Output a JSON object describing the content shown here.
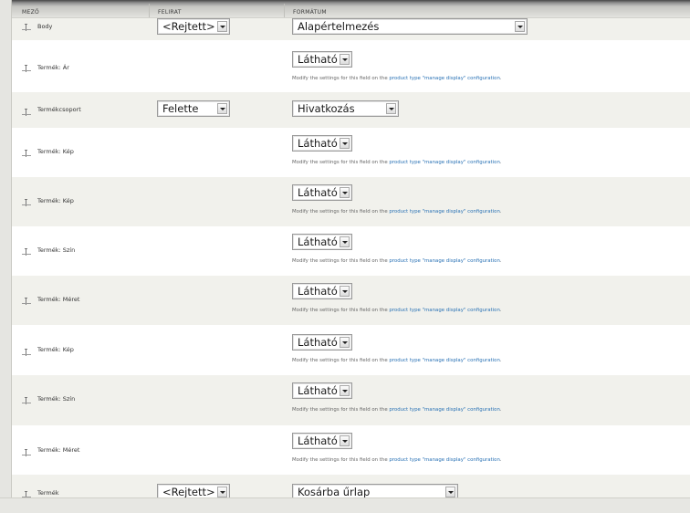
{
  "header": {
    "col_field": "MEZŐ",
    "col_label": "FELIRAT",
    "col_format": "FORMÁTUM"
  },
  "help": {
    "prefix": "Modify the settings for this field on the",
    "link": "product type \"manage display\" configuration",
    "suffix": "."
  },
  "rows": [
    {
      "name": "Body",
      "label": "<Rejtett>",
      "format": "Alapértelmezés"
    },
    {
      "name": "Termék: Ár",
      "format": "Látható"
    },
    {
      "name": "Termékcsoport",
      "label": "Felette",
      "format": "Hivatkozás"
    },
    {
      "name": "Termék: Kép",
      "format": "Látható"
    },
    {
      "name": "Termék: Kép",
      "format": "Látható"
    },
    {
      "name": "Termék: Szín",
      "format": "Látható"
    },
    {
      "name": "Termék: Méret",
      "format": "Látható"
    },
    {
      "name": "Termék: Kép",
      "format": "Látható"
    },
    {
      "name": "Termék: Szín",
      "format": "Látható"
    },
    {
      "name": "Termék: Méret",
      "format": "Látható"
    },
    {
      "name": "Termék",
      "label": "<Rejtett>",
      "format": "Kosárba űrlap"
    }
  ]
}
